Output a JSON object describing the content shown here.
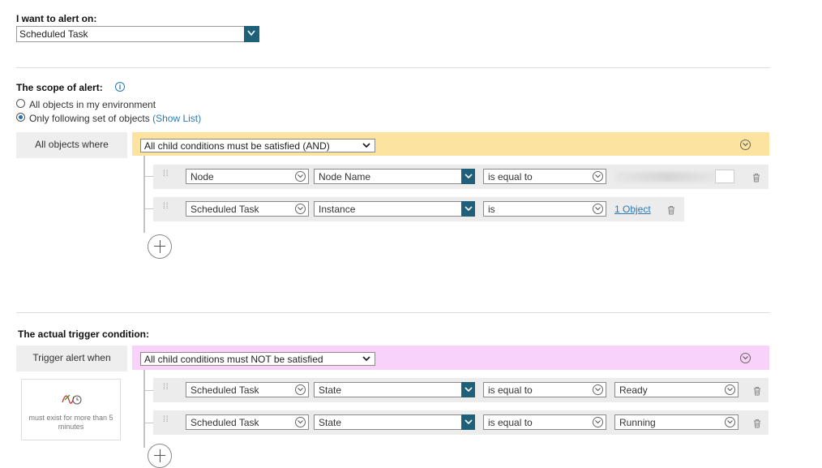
{
  "alert_on": {
    "label": "I want to alert on:",
    "selected": "Scheduled Task"
  },
  "scope": {
    "label": "The scope of alert:",
    "option_all": "All objects in my environment",
    "option_following": "Only following set of objects",
    "show_list": "(Show List)",
    "selected_option": "following",
    "where_label": "All objects where",
    "group_condition": "All child conditions must be satisfied (AND)",
    "rows": [
      {
        "object": "Node",
        "property": "Node Name",
        "operator": "is equal to",
        "value": ""
      },
      {
        "object": "Scheduled Task",
        "property": "Instance",
        "operator": "is",
        "value": "1 Object"
      }
    ]
  },
  "trigger": {
    "label": "The actual trigger condition:",
    "when_label": "Trigger alert when",
    "group_condition": "All child conditions must NOT be satisfied",
    "time_caption": "must exist for more than 5 minutes",
    "rows": [
      {
        "object": "Scheduled Task",
        "property": "State",
        "operator": "is equal to",
        "value": "Ready"
      },
      {
        "object": "Scheduled Task",
        "property": "State",
        "operator": "is equal to",
        "value": "Running"
      }
    ]
  },
  "colors": {
    "scope_band": "#fce3a0",
    "trigger_band": "#f9d2f9",
    "accent_dark": "#1e5f7a",
    "link": "#2a7ab8"
  },
  "icons": [
    "chevron-down-icon",
    "info-icon",
    "drag-handle-icon",
    "trash-icon",
    "plus-icon",
    "time-condition-icon"
  ]
}
